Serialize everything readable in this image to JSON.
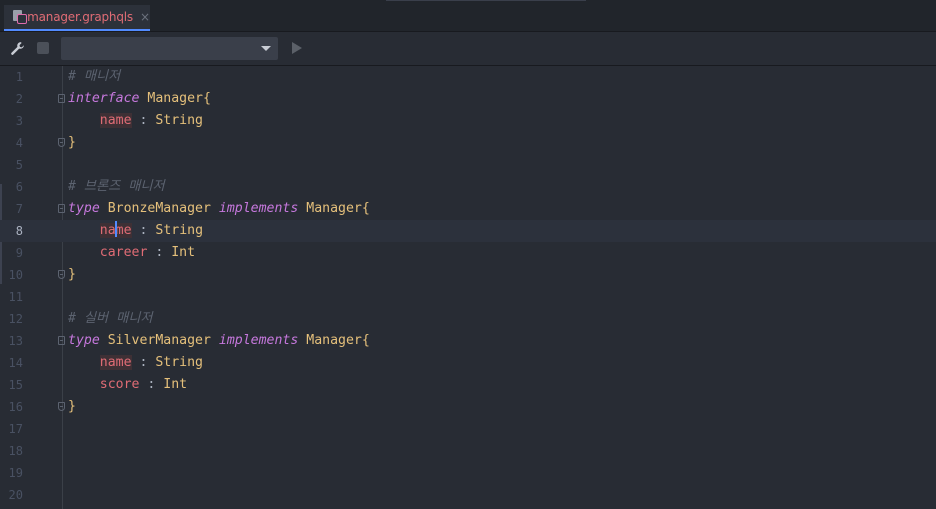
{
  "tab": {
    "filename": "manager.graphqls",
    "close_glyph": "×"
  },
  "toolbar": {
    "wrench_icon": "wrench-icon",
    "stop_icon": "stop-icon",
    "config_select_value": "",
    "run_icon": "run-icon"
  },
  "editor": {
    "current_line": "8",
    "lines": [
      {
        "num": "1",
        "tokens": [
          {
            "t": "# 매니저",
            "c": "t-comment"
          }
        ]
      },
      {
        "num": "2",
        "fold": "start",
        "tokens": [
          {
            "t": "interface",
            "c": "t-kw"
          },
          {
            "t": " ",
            "c": "t-punc"
          },
          {
            "t": "Manager",
            "c": "t-type"
          },
          {
            "t": "{",
            "c": "t-brace"
          }
        ]
      },
      {
        "num": "3",
        "tokens": [
          {
            "t": "    ",
            "c": "t-punc"
          },
          {
            "t": "name",
            "c": "t-field hl"
          },
          {
            "t": " : ",
            "c": "t-punc"
          },
          {
            "t": "String",
            "c": "t-type"
          }
        ]
      },
      {
        "num": "4",
        "fold": "end",
        "tokens": [
          {
            "t": "}",
            "c": "t-brace"
          }
        ]
      },
      {
        "num": "5",
        "tokens": []
      },
      {
        "num": "6",
        "tokens": [
          {
            "t": "# 브론즈 매니저",
            "c": "t-comment"
          }
        ]
      },
      {
        "num": "7",
        "fold": "start",
        "tokens": [
          {
            "t": "type",
            "c": "t-kw"
          },
          {
            "t": " ",
            "c": "t-punc"
          },
          {
            "t": "BronzeManager",
            "c": "t-type"
          },
          {
            "t": " ",
            "c": "t-punc"
          },
          {
            "t": "implements",
            "c": "t-kw"
          },
          {
            "t": " ",
            "c": "t-punc"
          },
          {
            "t": "Manager",
            "c": "t-type"
          },
          {
            "t": "{",
            "c": "t-brace"
          }
        ]
      },
      {
        "num": "8",
        "current": true,
        "tokens": [
          {
            "t": "    ",
            "c": "t-punc"
          },
          {
            "t": "na",
            "c": "t-field hl"
          },
          {
            "caret": true
          },
          {
            "t": "me",
            "c": "t-field hl"
          },
          {
            "t": " : ",
            "c": "t-punc"
          },
          {
            "t": "String",
            "c": "t-type"
          }
        ]
      },
      {
        "num": "9",
        "tokens": [
          {
            "t": "    ",
            "c": "t-punc"
          },
          {
            "t": "career",
            "c": "t-field"
          },
          {
            "t": " : ",
            "c": "t-punc"
          },
          {
            "t": "Int",
            "c": "t-type"
          }
        ]
      },
      {
        "num": "10",
        "fold": "end",
        "tokens": [
          {
            "t": "}",
            "c": "t-brace"
          }
        ]
      },
      {
        "num": "11",
        "tokens": []
      },
      {
        "num": "12",
        "tokens": [
          {
            "t": "# 실버 매니저",
            "c": "t-comment"
          }
        ]
      },
      {
        "num": "13",
        "fold": "start",
        "tokens": [
          {
            "t": "type",
            "c": "t-kw"
          },
          {
            "t": " ",
            "c": "t-punc"
          },
          {
            "t": "SilverManager",
            "c": "t-type"
          },
          {
            "t": " ",
            "c": "t-punc"
          },
          {
            "t": "implements",
            "c": "t-kw"
          },
          {
            "t": " ",
            "c": "t-punc"
          },
          {
            "t": "Manager",
            "c": "t-type"
          },
          {
            "t": "{",
            "c": "t-brace"
          }
        ]
      },
      {
        "num": "14",
        "tokens": [
          {
            "t": "    ",
            "c": "t-punc"
          },
          {
            "t": "name",
            "c": "t-field hl"
          },
          {
            "t": " : ",
            "c": "t-punc"
          },
          {
            "t": "String",
            "c": "t-type"
          }
        ]
      },
      {
        "num": "15",
        "tokens": [
          {
            "t": "    ",
            "c": "t-punc"
          },
          {
            "t": "score",
            "c": "t-field"
          },
          {
            "t": " : ",
            "c": "t-punc"
          },
          {
            "t": "Int",
            "c": "t-type"
          }
        ]
      },
      {
        "num": "16",
        "fold": "end",
        "tokens": [
          {
            "t": "}",
            "c": "t-brace"
          }
        ]
      },
      {
        "num": "17",
        "tokens": []
      },
      {
        "num": "18",
        "tokens": []
      },
      {
        "num": "19",
        "tokens": []
      },
      {
        "num": "20",
        "tokens": []
      }
    ]
  },
  "colors": {
    "background": "#282c34",
    "keyword": "#c678dd",
    "type": "#e5c07b",
    "field": "#e06c75",
    "comment": "#5c6370",
    "caret": "#528bff"
  }
}
